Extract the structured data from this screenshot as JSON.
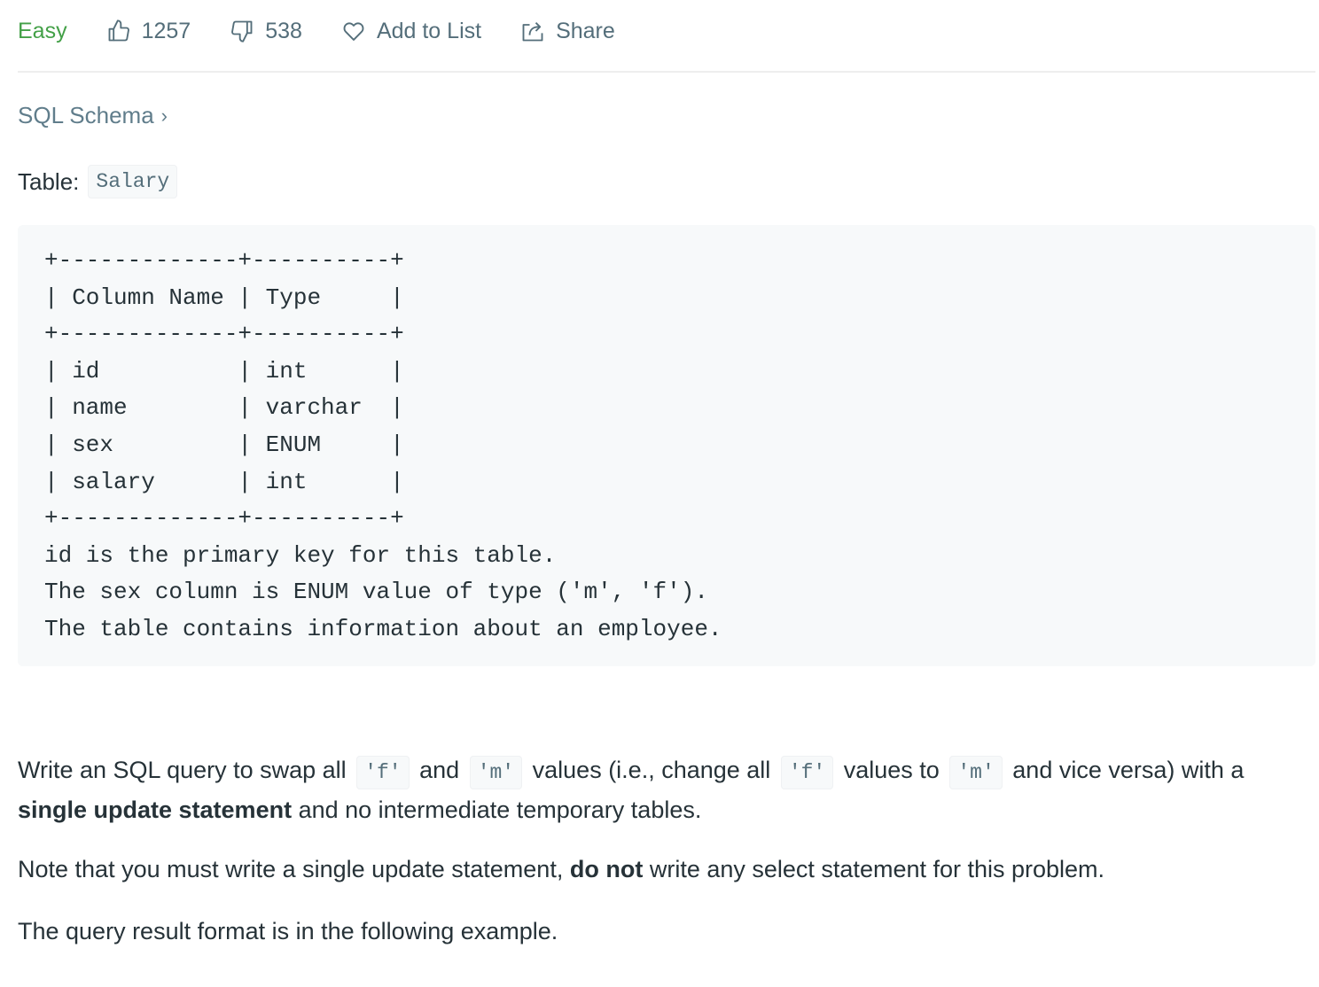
{
  "toolbar": {
    "difficulty": "Easy",
    "likes": "1257",
    "dislikes": "538",
    "add_to_list": "Add to List",
    "share": "Share"
  },
  "schema_link": {
    "label": "SQL Schema",
    "chevron": "›"
  },
  "table_line": {
    "label": "Table:",
    "table_name": "Salary"
  },
  "schema_block": {
    "text": "+-------------+----------+\n| Column Name | Type     |\n+-------------+----------+\n| id          | int      |\n| name        | varchar  |\n| sex         | ENUM     |\n| salary      | int      |\n+-------------+----------+\nid is the primary key for this table.\nThe sex column is ENUM value of type ('m', 'f').\nThe table contains information about an employee."
  },
  "description": {
    "p1_a": "Write an SQL query to swap all",
    "code_f": "'f'",
    "p1_and": "and",
    "code_m": "'m'",
    "p1_b": "values (i.e., change all",
    "p1_c": "values to",
    "p1_d": "and vice versa) with a",
    "p1_bold": "single update statement",
    "p1_e": "and no intermediate temporary tables.",
    "p2_a": "Note that you must write a single update statement,",
    "p2_bold": "do not",
    "p2_b": "write any select statement for this problem.",
    "p3": "The query result format is in the following example."
  },
  "icons": {
    "like": "thumbs-up-icon",
    "dislike": "thumbs-down-icon",
    "add_to_list": "heart-icon",
    "share": "share-icon"
  },
  "colors": {
    "difficulty_easy": "#43a047",
    "muted_text": "#546e7a",
    "code_background": "#f7f9fa"
  }
}
